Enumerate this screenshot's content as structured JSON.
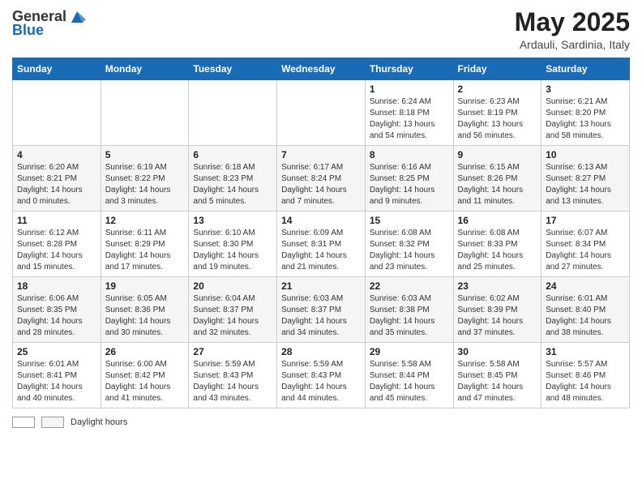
{
  "header": {
    "logo_general": "General",
    "logo_blue": "Blue",
    "month_title": "May 2025",
    "location": "Ardauli, Sardinia, Italy"
  },
  "columns": [
    "Sunday",
    "Monday",
    "Tuesday",
    "Wednesday",
    "Thursday",
    "Friday",
    "Saturday"
  ],
  "weeks": [
    [
      {
        "day": "",
        "info": ""
      },
      {
        "day": "",
        "info": ""
      },
      {
        "day": "",
        "info": ""
      },
      {
        "day": "",
        "info": ""
      },
      {
        "day": "1",
        "info": "Sunrise: 6:24 AM\nSunset: 8:18 PM\nDaylight: 13 hours and 54 minutes."
      },
      {
        "day": "2",
        "info": "Sunrise: 6:23 AM\nSunset: 8:19 PM\nDaylight: 13 hours and 56 minutes."
      },
      {
        "day": "3",
        "info": "Sunrise: 6:21 AM\nSunset: 8:20 PM\nDaylight: 13 hours and 58 minutes."
      }
    ],
    [
      {
        "day": "4",
        "info": "Sunrise: 6:20 AM\nSunset: 8:21 PM\nDaylight: 14 hours and 0 minutes."
      },
      {
        "day": "5",
        "info": "Sunrise: 6:19 AM\nSunset: 8:22 PM\nDaylight: 14 hours and 3 minutes."
      },
      {
        "day": "6",
        "info": "Sunrise: 6:18 AM\nSunset: 8:23 PM\nDaylight: 14 hours and 5 minutes."
      },
      {
        "day": "7",
        "info": "Sunrise: 6:17 AM\nSunset: 8:24 PM\nDaylight: 14 hours and 7 minutes."
      },
      {
        "day": "8",
        "info": "Sunrise: 6:16 AM\nSunset: 8:25 PM\nDaylight: 14 hours and 9 minutes."
      },
      {
        "day": "9",
        "info": "Sunrise: 6:15 AM\nSunset: 8:26 PM\nDaylight: 14 hours and 11 minutes."
      },
      {
        "day": "10",
        "info": "Sunrise: 6:13 AM\nSunset: 8:27 PM\nDaylight: 14 hours and 13 minutes."
      }
    ],
    [
      {
        "day": "11",
        "info": "Sunrise: 6:12 AM\nSunset: 8:28 PM\nDaylight: 14 hours and 15 minutes."
      },
      {
        "day": "12",
        "info": "Sunrise: 6:11 AM\nSunset: 8:29 PM\nDaylight: 14 hours and 17 minutes."
      },
      {
        "day": "13",
        "info": "Sunrise: 6:10 AM\nSunset: 8:30 PM\nDaylight: 14 hours and 19 minutes."
      },
      {
        "day": "14",
        "info": "Sunrise: 6:09 AM\nSunset: 8:31 PM\nDaylight: 14 hours and 21 minutes."
      },
      {
        "day": "15",
        "info": "Sunrise: 6:08 AM\nSunset: 8:32 PM\nDaylight: 14 hours and 23 minutes."
      },
      {
        "day": "16",
        "info": "Sunrise: 6:08 AM\nSunset: 8:33 PM\nDaylight: 14 hours and 25 minutes."
      },
      {
        "day": "17",
        "info": "Sunrise: 6:07 AM\nSunset: 8:34 PM\nDaylight: 14 hours and 27 minutes."
      }
    ],
    [
      {
        "day": "18",
        "info": "Sunrise: 6:06 AM\nSunset: 8:35 PM\nDaylight: 14 hours and 28 minutes."
      },
      {
        "day": "19",
        "info": "Sunrise: 6:05 AM\nSunset: 8:36 PM\nDaylight: 14 hours and 30 minutes."
      },
      {
        "day": "20",
        "info": "Sunrise: 6:04 AM\nSunset: 8:37 PM\nDaylight: 14 hours and 32 minutes."
      },
      {
        "day": "21",
        "info": "Sunrise: 6:03 AM\nSunset: 8:37 PM\nDaylight: 14 hours and 34 minutes."
      },
      {
        "day": "22",
        "info": "Sunrise: 6:03 AM\nSunset: 8:38 PM\nDaylight: 14 hours and 35 minutes."
      },
      {
        "day": "23",
        "info": "Sunrise: 6:02 AM\nSunset: 8:39 PM\nDaylight: 14 hours and 37 minutes."
      },
      {
        "day": "24",
        "info": "Sunrise: 6:01 AM\nSunset: 8:40 PM\nDaylight: 14 hours and 38 minutes."
      }
    ],
    [
      {
        "day": "25",
        "info": "Sunrise: 6:01 AM\nSunset: 8:41 PM\nDaylight: 14 hours and 40 minutes."
      },
      {
        "day": "26",
        "info": "Sunrise: 6:00 AM\nSunset: 8:42 PM\nDaylight: 14 hours and 41 minutes."
      },
      {
        "day": "27",
        "info": "Sunrise: 5:59 AM\nSunset: 8:43 PM\nDaylight: 14 hours and 43 minutes."
      },
      {
        "day": "28",
        "info": "Sunrise: 5:59 AM\nSunset: 8:43 PM\nDaylight: 14 hours and 44 minutes."
      },
      {
        "day": "29",
        "info": "Sunrise: 5:58 AM\nSunset: 8:44 PM\nDaylight: 14 hours and 45 minutes."
      },
      {
        "day": "30",
        "info": "Sunrise: 5:58 AM\nSunset: 8:45 PM\nDaylight: 14 hours and 47 minutes."
      },
      {
        "day": "31",
        "info": "Sunrise: 5:57 AM\nSunset: 8:46 PM\nDaylight: 14 hours and 48 minutes."
      }
    ]
  ],
  "legend": {
    "label": "Daylight hours"
  }
}
